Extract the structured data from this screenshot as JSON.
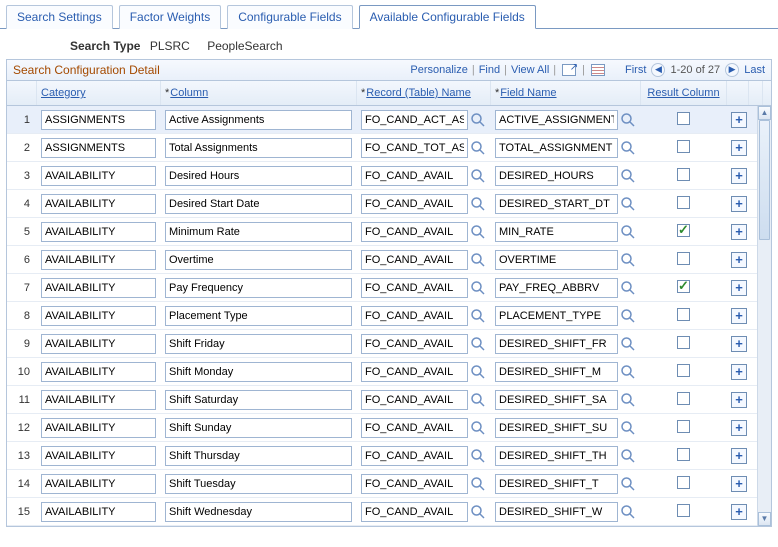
{
  "tabs": [
    {
      "label": "Search Settings",
      "active": false
    },
    {
      "label": "Factor Weights",
      "active": false
    },
    {
      "label": "Configurable Fields",
      "active": false
    },
    {
      "label": "Available Configurable Fields",
      "active": true
    }
  ],
  "search_type": {
    "label": "Search Type",
    "code": "PLSRC",
    "desc": "PeopleSearch"
  },
  "grid": {
    "title": "Search Configuration Detail",
    "toolbar": {
      "personalize": "Personalize",
      "find": "Find",
      "view_all": "View All",
      "first": "First",
      "range": "1-20 of 27",
      "last": "Last"
    },
    "columns": {
      "category": "Category",
      "column": "Column",
      "record": "Record (Table) Name",
      "field": "Field Name",
      "result": "Result Column"
    },
    "rows": [
      {
        "n": 1,
        "cat": "ASSIGNMENTS",
        "col": "Active Assignments",
        "rec": "FO_CAND_ACT_AS",
        "field": "ACTIVE_ASSIGNMENT",
        "res": false,
        "selected": true
      },
      {
        "n": 2,
        "cat": "ASSIGNMENTS",
        "col": "Total Assignments",
        "rec": "FO_CAND_TOT_AS",
        "field": "TOTAL_ASSIGNMENT",
        "res": false
      },
      {
        "n": 3,
        "cat": "AVAILABILITY",
        "col": "Desired Hours",
        "rec": "FO_CAND_AVAIL",
        "field": "DESIRED_HOURS",
        "res": false
      },
      {
        "n": 4,
        "cat": "AVAILABILITY",
        "col": "Desired Start Date",
        "rec": "FO_CAND_AVAIL",
        "field": "DESIRED_START_DT",
        "res": false
      },
      {
        "n": 5,
        "cat": "AVAILABILITY",
        "col": "Minimum Rate",
        "rec": "FO_CAND_AVAIL",
        "field": "MIN_RATE",
        "res": true
      },
      {
        "n": 6,
        "cat": "AVAILABILITY",
        "col": "Overtime",
        "rec": "FO_CAND_AVAIL",
        "field": "OVERTIME",
        "res": false
      },
      {
        "n": 7,
        "cat": "AVAILABILITY",
        "col": "Pay Frequency",
        "rec": "FO_CAND_AVAIL",
        "field": "PAY_FREQ_ABBRV",
        "res": true
      },
      {
        "n": 8,
        "cat": "AVAILABILITY",
        "col": "Placement Type",
        "rec": "FO_CAND_AVAIL",
        "field": "PLACEMENT_TYPE",
        "res": false
      },
      {
        "n": 9,
        "cat": "AVAILABILITY",
        "col": "Shift Friday",
        "rec": "FO_CAND_AVAIL",
        "field": "DESIRED_SHIFT_FR",
        "res": false
      },
      {
        "n": 10,
        "cat": "AVAILABILITY",
        "col": "Shift Monday",
        "rec": "FO_CAND_AVAIL",
        "field": "DESIRED_SHIFT_M",
        "res": false
      },
      {
        "n": 11,
        "cat": "AVAILABILITY",
        "col": "Shift Saturday",
        "rec": "FO_CAND_AVAIL",
        "field": "DESIRED_SHIFT_SA",
        "res": false
      },
      {
        "n": 12,
        "cat": "AVAILABILITY",
        "col": "Shift Sunday",
        "rec": "FO_CAND_AVAIL",
        "field": "DESIRED_SHIFT_SU",
        "res": false
      },
      {
        "n": 13,
        "cat": "AVAILABILITY",
        "col": "Shift Thursday",
        "rec": "FO_CAND_AVAIL",
        "field": "DESIRED_SHIFT_TH",
        "res": false
      },
      {
        "n": 14,
        "cat": "AVAILABILITY",
        "col": "Shift Tuesday",
        "rec": "FO_CAND_AVAIL",
        "field": "DESIRED_SHIFT_T",
        "res": false
      },
      {
        "n": 15,
        "cat": "AVAILABILITY",
        "col": "Shift Wednesday",
        "rec": "FO_CAND_AVAIL",
        "field": "DESIRED_SHIFT_W",
        "res": false
      }
    ]
  }
}
